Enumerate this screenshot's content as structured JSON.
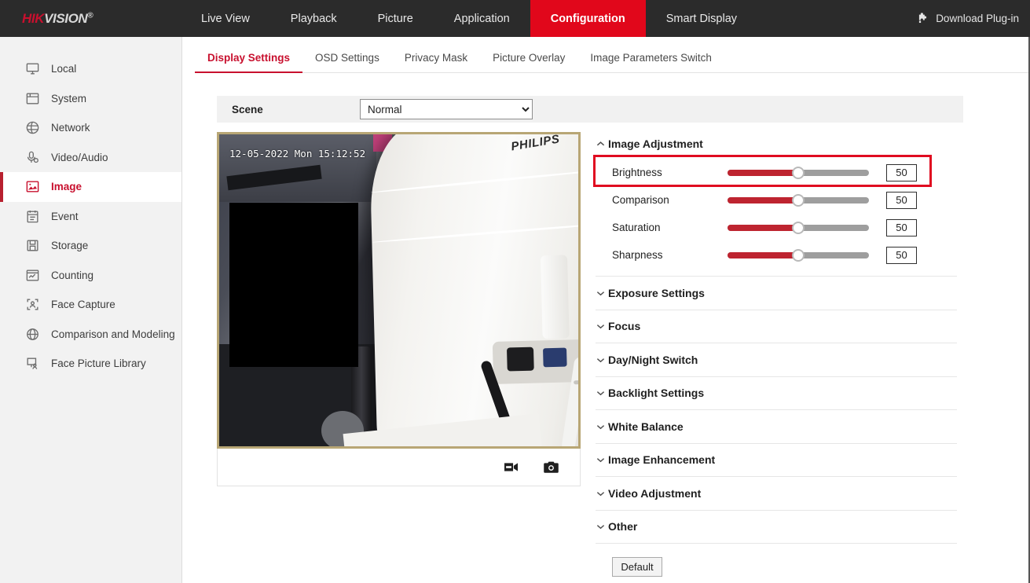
{
  "brand": {
    "name_part1": "HIK",
    "name_part2": "VISION",
    "registered": "®"
  },
  "topnav": {
    "items": [
      {
        "label": "Live View",
        "active": false
      },
      {
        "label": "Playback",
        "active": false
      },
      {
        "label": "Picture",
        "active": false
      },
      {
        "label": "Application",
        "active": false
      },
      {
        "label": "Configuration",
        "active": true
      },
      {
        "label": "Smart Display",
        "active": false
      }
    ],
    "plugin_label": "Download Plug-in",
    "plugin_icon": "puzzle-piece-icon",
    "active_color": "#e1071b",
    "bar_color": "#2b2b2b"
  },
  "sidebar": {
    "items": [
      {
        "label": "Local",
        "icon": "monitor-icon",
        "active": false
      },
      {
        "label": "System",
        "icon": "window-icon",
        "active": false
      },
      {
        "label": "Network",
        "icon": "globe-icon",
        "active": false
      },
      {
        "label": "Video/Audio",
        "icon": "microphone-gear-icon",
        "active": false
      },
      {
        "label": "Image",
        "icon": "picture-icon",
        "active": true
      },
      {
        "label": "Event",
        "icon": "calendar-icon",
        "active": false
      },
      {
        "label": "Storage",
        "icon": "disk-icon",
        "active": false
      },
      {
        "label": "Counting",
        "icon": "chart-frame-icon",
        "active": false
      },
      {
        "label": "Face Capture",
        "icon": "face-bracket-icon",
        "active": false
      },
      {
        "label": "Comparison and Modeling",
        "icon": "sphere-icon",
        "active": false
      },
      {
        "label": "Face Picture Library",
        "icon": "person-screen-icon",
        "active": false
      }
    ],
    "active_color": "#c8102e"
  },
  "subtabs": {
    "items": [
      {
        "label": "Display Settings",
        "active": true
      },
      {
        "label": "OSD Settings",
        "active": false
      },
      {
        "label": "Privacy Mask",
        "active": false
      },
      {
        "label": "Picture Overlay",
        "active": false
      },
      {
        "label": "Image Parameters Switch",
        "active": false
      }
    ]
  },
  "scene": {
    "label": "Scene",
    "selected": "Normal",
    "options": [
      "Normal"
    ]
  },
  "video_preview": {
    "timestamp": "12-05-2022 Mon 15:12:52",
    "monitor_brand": "PHILIPS",
    "privacy_mask": true,
    "toolbar": [
      {
        "icon": "video-record-icon",
        "name": "start-recording-button"
      },
      {
        "icon": "camera-snapshot-icon",
        "name": "capture-snapshot-button"
      }
    ],
    "border_color": "#b8a675"
  },
  "image_adjustment": {
    "title": "Image Adjustment",
    "expanded": true,
    "caret": "caret-up-icon",
    "highlight_color": "#e00b20",
    "highlighted_row": "Brightness",
    "sliders": [
      {
        "label": "Brightness",
        "value": "50",
        "percent": 50,
        "highlighted": true
      },
      {
        "label": "Comparison",
        "value": "50",
        "percent": 50,
        "highlighted": false
      },
      {
        "label": "Saturation",
        "value": "50",
        "percent": 50,
        "highlighted": false
      },
      {
        "label": "Sharpness",
        "value": "50",
        "percent": 50,
        "highlighted": false
      }
    ],
    "slider_fill_color": "#be2430",
    "slider_track_color": "#9e9e9e"
  },
  "collapsed_sections": [
    {
      "label": "Exposure Settings",
      "caret": "caret-down-icon"
    },
    {
      "label": "Focus",
      "caret": "caret-down-icon"
    },
    {
      "label": "Day/Night Switch",
      "caret": "caret-down-icon"
    },
    {
      "label": "Backlight Settings",
      "caret": "caret-down-icon"
    },
    {
      "label": "White Balance",
      "caret": "caret-down-icon"
    },
    {
      "label": "Image Enhancement",
      "caret": "caret-down-icon"
    },
    {
      "label": "Video Adjustment",
      "caret": "caret-down-icon"
    },
    {
      "label": "Other",
      "caret": "caret-down-icon"
    }
  ],
  "footer": {
    "default_button": "Default"
  }
}
